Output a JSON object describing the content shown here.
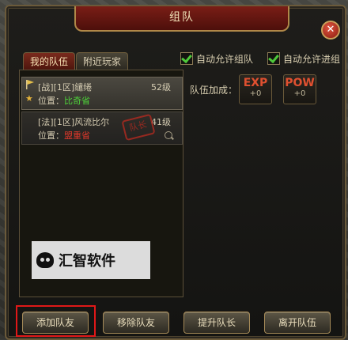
{
  "title": "组队",
  "tabs": [
    {
      "label": "我的队伍",
      "active": true
    },
    {
      "label": "附近玩家",
      "active": false
    }
  ],
  "options": {
    "auto_team_label": "自动允许组队",
    "auto_team_checked": true,
    "auto_join_label": "自动允许进组",
    "auto_join_checked": true
  },
  "members": [
    {
      "name": "[战][1区]缱绻",
      "level": "52级",
      "location_label": "位置：",
      "location": "比奇省",
      "location_color": "#4ed23a",
      "is_leader": true
    },
    {
      "name": "[法][1区]风流比尔",
      "level": "41级",
      "location_label": "位置：",
      "location": "盟重省",
      "location_color": "#e0382a",
      "is_leader": false,
      "stamp": "队长"
    }
  ],
  "bonus": {
    "label": "队伍加成：",
    "exp_name": "EXP",
    "exp_value": "+0",
    "pow_name": "POW",
    "pow_value": "+0"
  },
  "watermark": "汇智软件",
  "buttons": {
    "add": "添加队友",
    "remove": "移除队友",
    "promote": "提升队长",
    "leave": "离开队伍"
  },
  "colors": {
    "title_red": "#7a1e16",
    "highlight": "#e01818",
    "check_green": "#4ec83a"
  }
}
